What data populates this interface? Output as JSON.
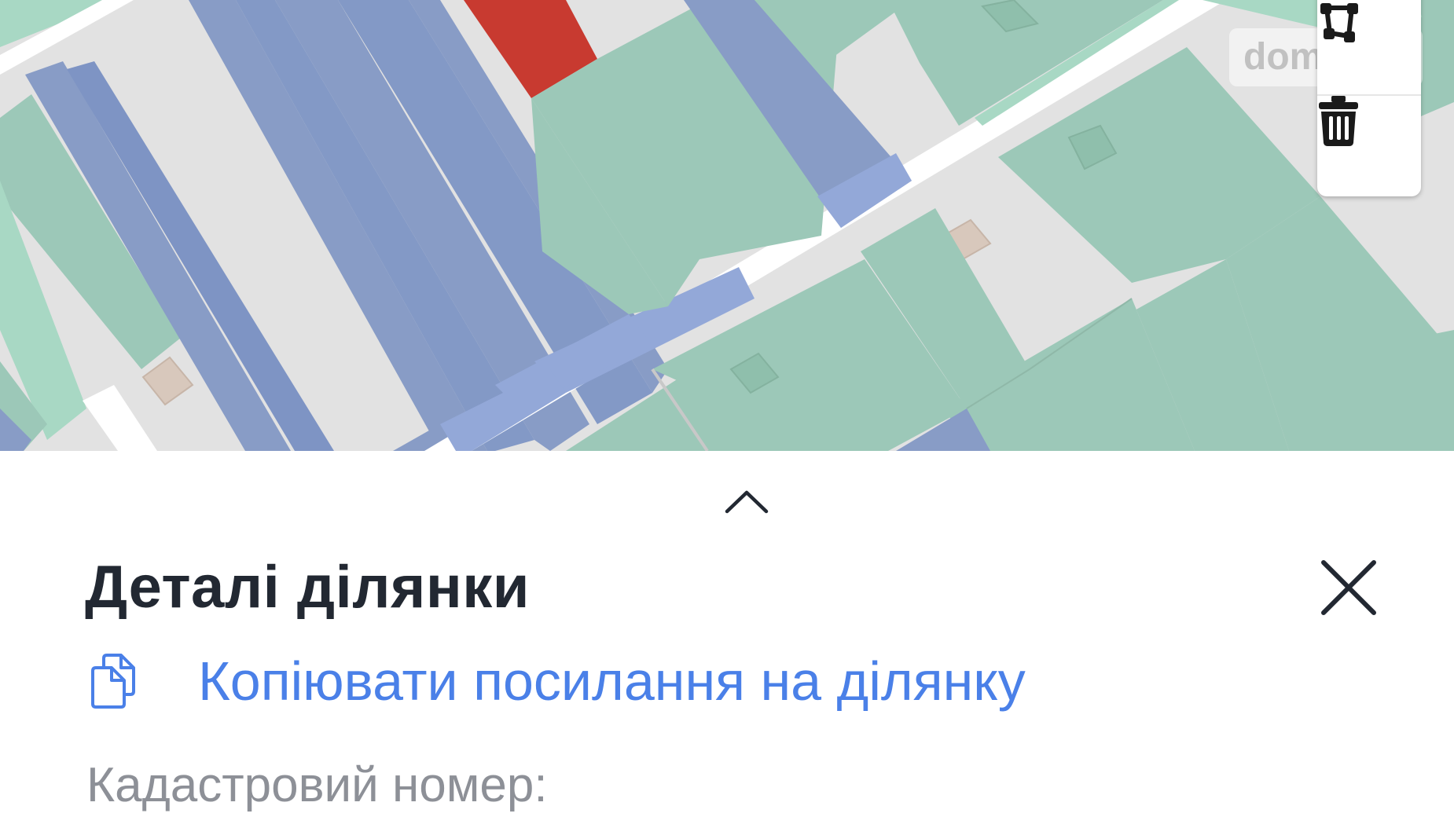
{
  "map": {
    "watermark_text": "dom",
    "tools": [
      {
        "name": "area-select",
        "icon": "polygon-icon"
      },
      {
        "name": "clear",
        "icon": "trash-icon"
      }
    ],
    "colors": {
      "background": "#e2e2e2",
      "parcel_green": "#9cc8b8",
      "parcel_light_green": "#a8d8c4",
      "parcel_blue": "#889cc6",
      "parcel_selected_red": "#c83a30",
      "building_tan": "#d8c8bc",
      "road": "#ffffff"
    }
  },
  "sheet": {
    "expand_icon": "chevron-up-icon",
    "title": "Деталі ділянки",
    "close_icon": "close-icon",
    "copy_link_icon": "copy-icon",
    "copy_link_text": "Копіювати посилання на ділянку",
    "cadastral_label": "Кадастровий номер:",
    "colors": {
      "title": "#222832",
      "link": "#4a80e8",
      "label": "#8d9097"
    }
  }
}
